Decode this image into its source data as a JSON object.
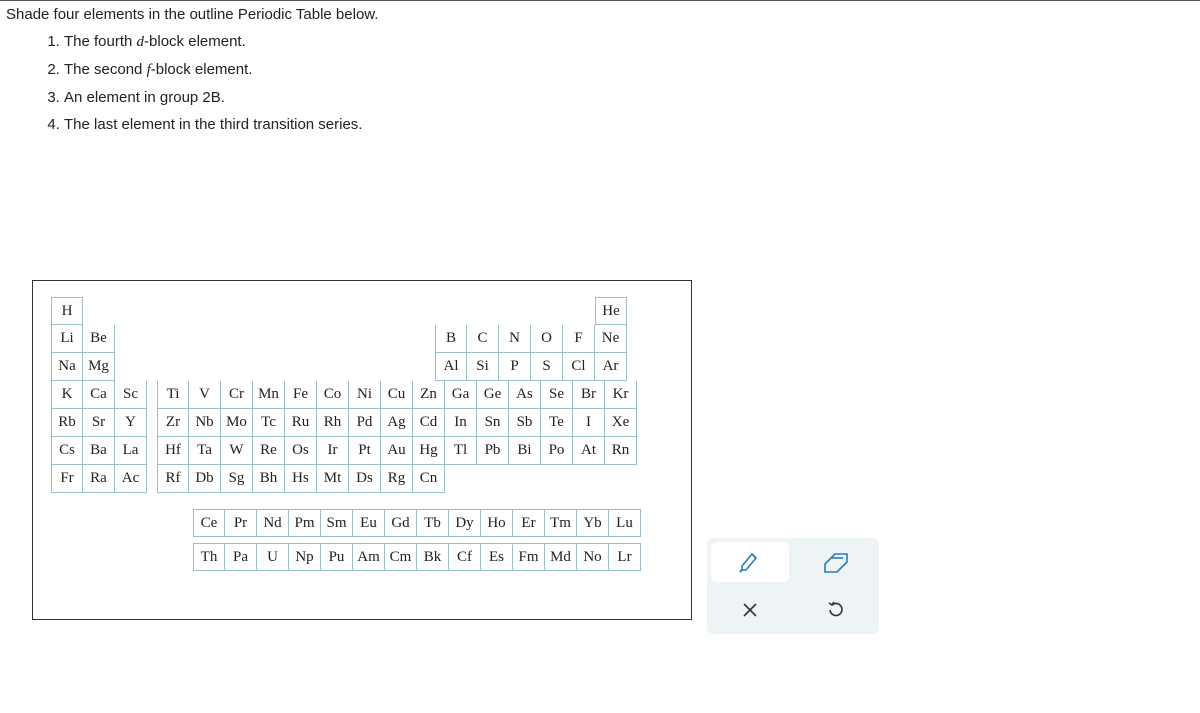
{
  "question": {
    "prompt": "Shade four elements in the outline Periodic Table below.",
    "items": [
      {
        "pre": "The fourth ",
        "it": "d",
        "post": "-block element."
      },
      {
        "pre": "The second ",
        "it": "f",
        "post": "-block element."
      },
      {
        "pre": "An element in group 2B.",
        "it": "",
        "post": ""
      },
      {
        "pre": "The last element in the third transition series.",
        "it": "",
        "post": ""
      }
    ]
  },
  "periodic_table": {
    "r1": [
      "H",
      "He"
    ],
    "r2": [
      "Li",
      "Be",
      "B",
      "C",
      "N",
      "O",
      "F",
      "Ne"
    ],
    "r3": [
      "Na",
      "Mg",
      "Al",
      "Si",
      "P",
      "S",
      "Cl",
      "Ar"
    ],
    "r4": [
      "K",
      "Ca",
      "Sc",
      "Ti",
      "V",
      "Cr",
      "Mn",
      "Fe",
      "Co",
      "Ni",
      "Cu",
      "Zn",
      "Ga",
      "Ge",
      "As",
      "Se",
      "Br",
      "Kr"
    ],
    "r5": [
      "Rb",
      "Sr",
      "Y",
      "Zr",
      "Nb",
      "Mo",
      "Tc",
      "Ru",
      "Rh",
      "Pd",
      "Ag",
      "Cd",
      "In",
      "Sn",
      "Sb",
      "Te",
      "I",
      "Xe"
    ],
    "r6": [
      "Cs",
      "Ba",
      "La",
      "Hf",
      "Ta",
      "W",
      "Re",
      "Os",
      "Ir",
      "Pt",
      "Au",
      "Hg",
      "Tl",
      "Pb",
      "Bi",
      "Po",
      "At",
      "Rn"
    ],
    "r7": [
      "Fr",
      "Ra",
      "Ac",
      "Rf",
      "Db",
      "Sg",
      "Bh",
      "Hs",
      "Mt",
      "Ds",
      "Rg",
      "Cn"
    ],
    "la": [
      "Ce",
      "Pr",
      "Nd",
      "Pm",
      "Sm",
      "Eu",
      "Gd",
      "Tb",
      "Dy",
      "Ho",
      "Er",
      "Tm",
      "Yb",
      "Lu"
    ],
    "ac": [
      "Th",
      "Pa",
      "U",
      "Np",
      "Pu",
      "Am",
      "Cm",
      "Bk",
      "Cf",
      "Es",
      "Fm",
      "Md",
      "No",
      "Lr"
    ]
  },
  "tools": {
    "highlight": "highlight",
    "eraser": "eraser",
    "close": "close",
    "undo": "undo"
  }
}
